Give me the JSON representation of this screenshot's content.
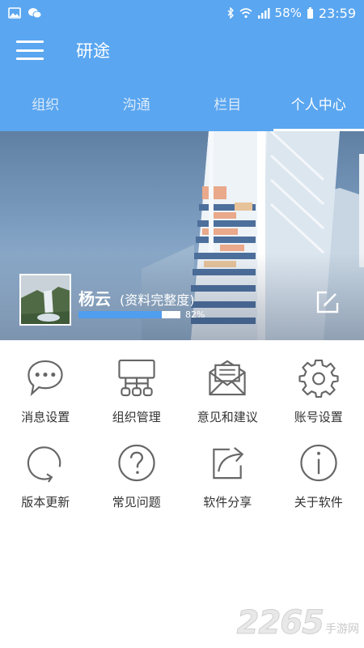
{
  "status_bar": {
    "battery": "58%",
    "time": "23:59"
  },
  "app_bar": {
    "title": "研途"
  },
  "tabs": [
    {
      "label": "组织",
      "active": false
    },
    {
      "label": "沟通",
      "active": false
    },
    {
      "label": "栏目",
      "active": false
    },
    {
      "label": "个人中心",
      "active": true
    }
  ],
  "profile": {
    "name": "杨云",
    "completeness_label": "(资料完整度)",
    "completeness_value": 0.82,
    "completeness_text": "82%"
  },
  "menu": [
    {
      "label": "消息设置",
      "icon": "chat-bubble-icon"
    },
    {
      "label": "组织管理",
      "icon": "org-chart-icon"
    },
    {
      "label": "意见和建议",
      "icon": "envelope-icon"
    },
    {
      "label": "账号设置",
      "icon": "gear-icon"
    },
    {
      "label": "版本更新",
      "icon": "refresh-icon"
    },
    {
      "label": "常见问题",
      "icon": "question-icon"
    },
    {
      "label": "软件分享",
      "icon": "share-icon"
    },
    {
      "label": "关于软件",
      "icon": "info-icon"
    }
  ],
  "watermark": {
    "number": "2265",
    "text": "手游网"
  },
  "colors": {
    "primary": "#5aa6f0",
    "progress": "#4f9ef0",
    "icon_stroke": "#666666"
  }
}
